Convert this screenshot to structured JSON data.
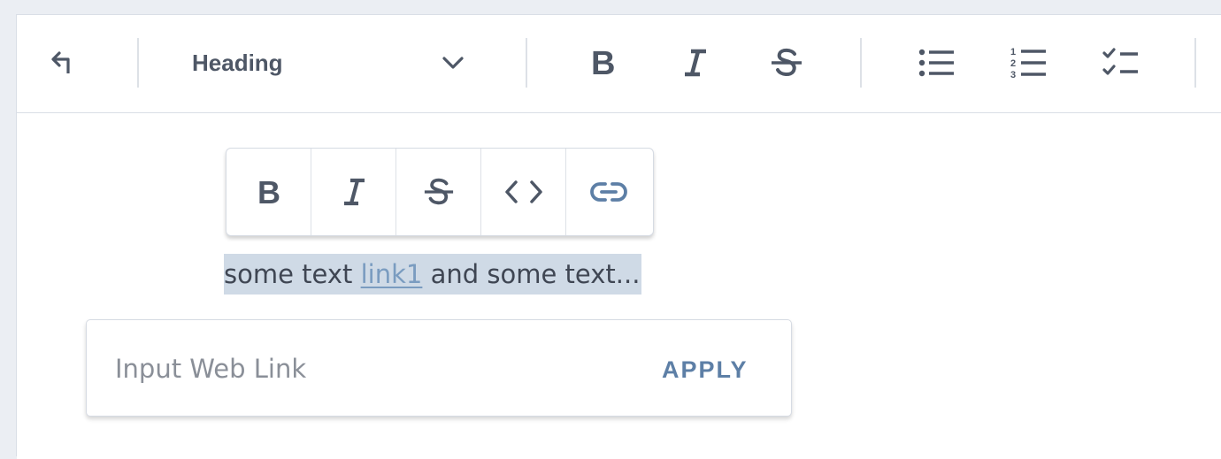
{
  "toolbar": {
    "undo_icon": "undo-arrow-icon",
    "heading_select": {
      "value": "Heading"
    },
    "buttons": [
      "bold",
      "italic",
      "strikethrough",
      "bullet-list",
      "numbered-list",
      "checklist"
    ]
  },
  "bubble_menu": {
    "buttons": [
      "bold",
      "italic",
      "strikethrough",
      "code",
      "link"
    ],
    "active_color": "#5d7fa6"
  },
  "content": {
    "text_before": "some text ",
    "link_text": "link1",
    "text_after": " and some text..."
  },
  "link_input": {
    "placeholder": "Input Web Link",
    "value": "",
    "apply_label": "APPLY"
  },
  "colors": {
    "icon": "#4e5766",
    "link": "#7a9cc0",
    "selection": "#cfdae6",
    "accent": "#5d7fa6"
  }
}
